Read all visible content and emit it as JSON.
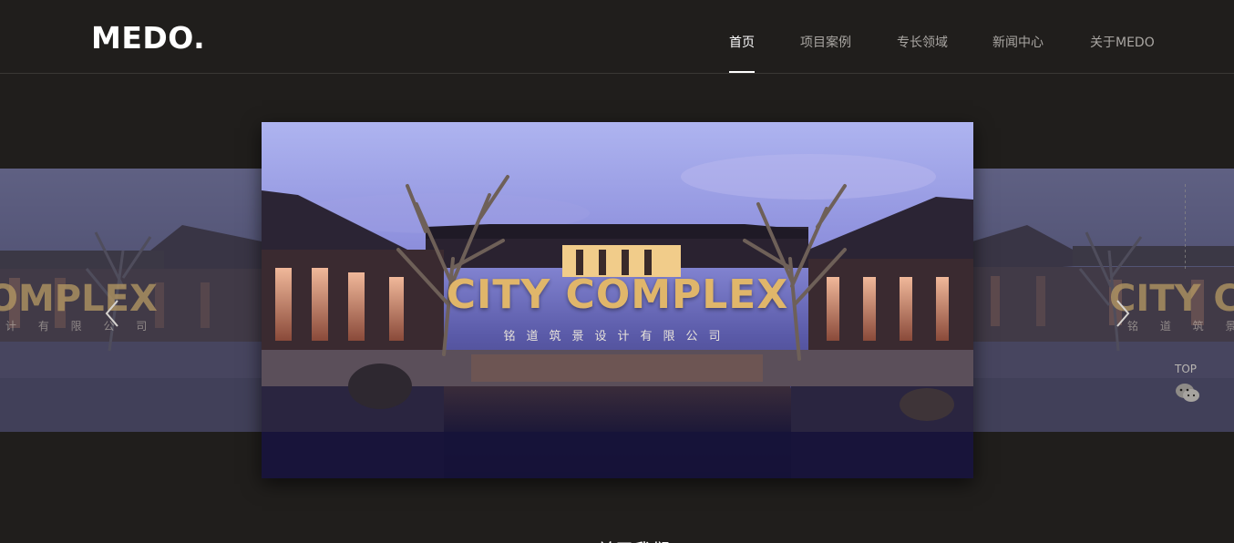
{
  "header": {
    "logo": "MEDO.",
    "nav": [
      {
        "label": "首页",
        "active": true
      },
      {
        "label": "项目案例",
        "active": false
      },
      {
        "label": "专长领域",
        "active": false
      },
      {
        "label": "新闻中心",
        "active": false
      },
      {
        "label": "关于MEDO",
        "active": false
      }
    ]
  },
  "carousel": {
    "active_slide": {
      "title": "CITY COMPLEX",
      "subtitle": "铭道筑景设计有限公司"
    },
    "left_slide": {
      "title_fragment": "OMPLEX",
      "subtitle_fragment": "计 有 限 公 司"
    },
    "right_slide": {
      "title_fragment": "CITY CO",
      "subtitle_fragment": "铭 道 筑 景 设"
    },
    "prev_icon": "chevron-left-icon",
    "next_icon": "chevron-right-icon"
  },
  "side_tools": {
    "top_label": "TOP",
    "wechat_icon": "wechat-icon"
  },
  "section_peek": "关于我们",
  "colors": {
    "background": "#201e1c",
    "title_gold": "#e0b66a",
    "nav_active": "#ffffff",
    "nav_inactive": "#a9a6a2"
  }
}
